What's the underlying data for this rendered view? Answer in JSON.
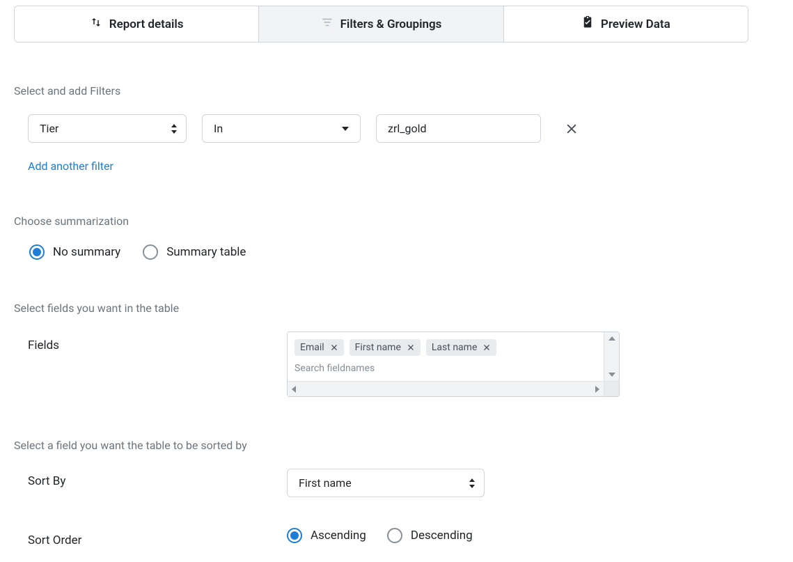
{
  "tabs": {
    "report_details": "Report details",
    "filters_groupings": "Filters & Groupings",
    "preview_data": "Preview Data",
    "active": 1
  },
  "filters": {
    "section_title": "Select and add Filters",
    "field": "Tier",
    "operator": "In",
    "value": "zrl_gold",
    "add_link": "Add another filter"
  },
  "summarization": {
    "section_title": "Choose summarization",
    "options": {
      "no_summary": "No summary",
      "summary_table": "Summary table"
    },
    "selected": "no_summary"
  },
  "fields": {
    "section_title": "Select fields you want in the table",
    "label": "Fields",
    "tags": [
      "Email",
      "First name",
      "Last name"
    ],
    "placeholder": "Search fieldnames"
  },
  "sort": {
    "section_title": "Select a field you want the table to be sorted by",
    "by_label": "Sort By",
    "by_value": "First name",
    "order_label": "Sort Order",
    "asc": "Ascending",
    "desc": "Descending",
    "selected": "asc"
  }
}
